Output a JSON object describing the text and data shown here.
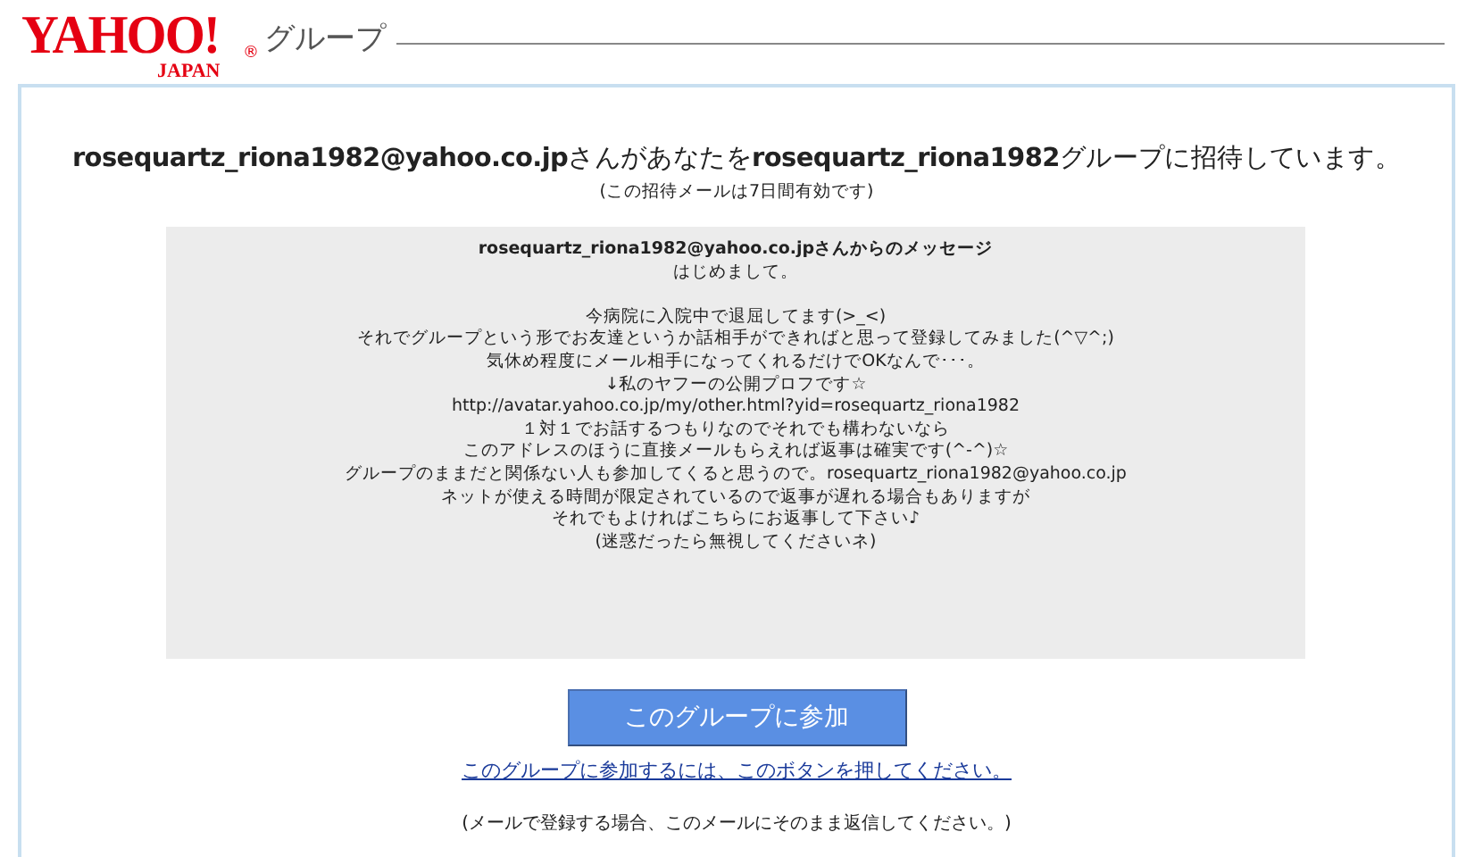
{
  "header": {
    "logo": {
      "word": "YAHOO!",
      "sub": "JAPAN",
      "mark": "®"
    },
    "section": "グループ"
  },
  "invitation": {
    "headline": "**rosequartz_riona1982@yahoo.co.jp**さんがあなたを**rosequartz_riona1982**グループに招待しています。",
    "validity": "(この招待メールは7日間有効です)"
  },
  "message": {
    "sender": "rosequartz_riona1982@yahoo.co.jpさんからのメッセージ",
    "paragraphs": [
      [
        "はじめまして。"
      ],
      [
        "今病院に入院中で退屈してます(>_<)",
        "それでグループという形でお友達というか話相手ができればと思って登録してみました(^▽^;)",
        "気休め程度にメール相手になってくれるだけでOKなんで･･･。",
        "↓私のヤフーの公開プロフです☆",
        "http://avatar.yahoo.co.jp/my/other.html?yid=rosequartz_riona1982",
        "１対１でお話するつもりなのでそれでも構わないなら",
        "このアドレスのほうに直接メールもらえれば返事は確実です(^-^)☆",
        "グループのままだと関係ない人も参加してくると思うので。rosequartz_riona1982@yahoo.co.jp",
        "ネットが使える時間が限定されているので返事が遅れる場合もありますが",
        "それでもよければこちらにお返事して下さい♪",
        "(迷惑だったら無視してくださいネ)"
      ]
    ]
  },
  "join_button": "このグループに参加",
  "join_link": "このグループに参加するには、このボタンを押してください。",
  "mail_note": "(メールで登録する場合、このメールにそのまま返信してください。)"
}
